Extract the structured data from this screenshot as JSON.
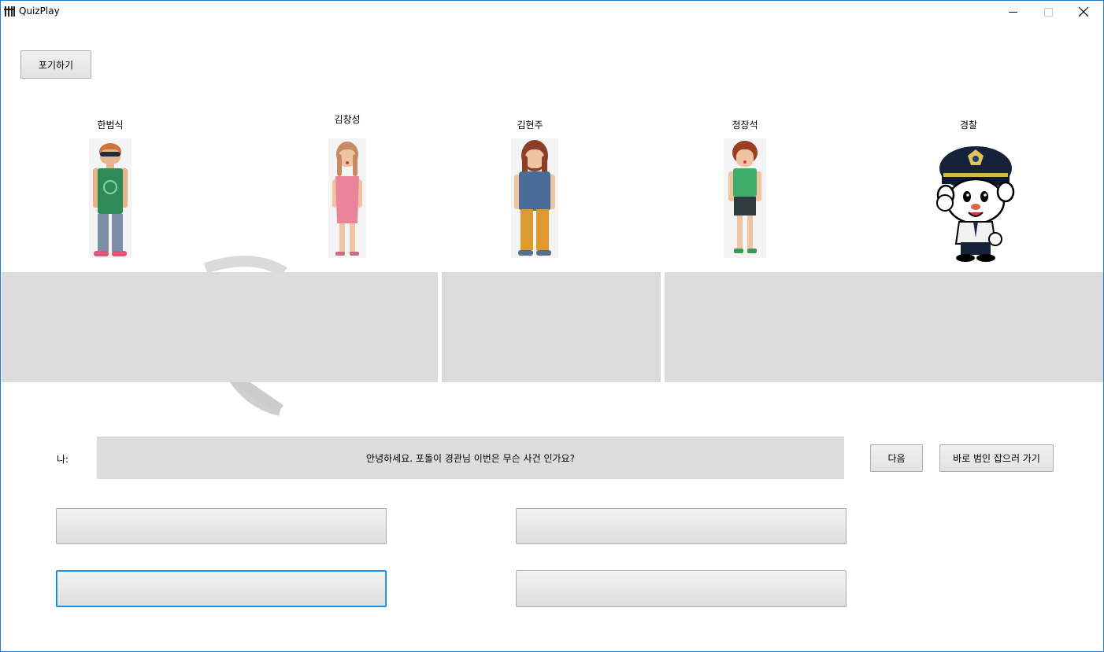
{
  "window": {
    "title": "QuizPlay",
    "icons": {
      "app": "app-icon",
      "minimize": "minimize-icon",
      "maximize": "maximize-icon",
      "close": "close-icon"
    }
  },
  "toolbar": {
    "give_up_label": "포기하기"
  },
  "characters": [
    {
      "name": "한범식",
      "icon": "man-sunglasses-avatar"
    },
    {
      "name": "김창성",
      "icon": "woman-pink-dress-avatar"
    },
    {
      "name": "김현주",
      "icon": "woman-blue-top-avatar"
    },
    {
      "name": "정장석",
      "icon": "woman-green-top-avatar"
    },
    {
      "name": "경찰",
      "icon": "police-officer-cartoon"
    }
  ],
  "dialog": {
    "speaker_label": "나:",
    "message": "안녕하세요. 포돌이 경관님 이번은 무슨 사건 인가요?",
    "next_label": "다음",
    "catch_label": "바로 범인 잡으러 가기"
  },
  "answers": [
    "",
    "",
    "",
    ""
  ],
  "colors": {
    "panel": "#dcdcdc",
    "window_border": "#1e7bd2",
    "focus": "#0c84d8"
  }
}
